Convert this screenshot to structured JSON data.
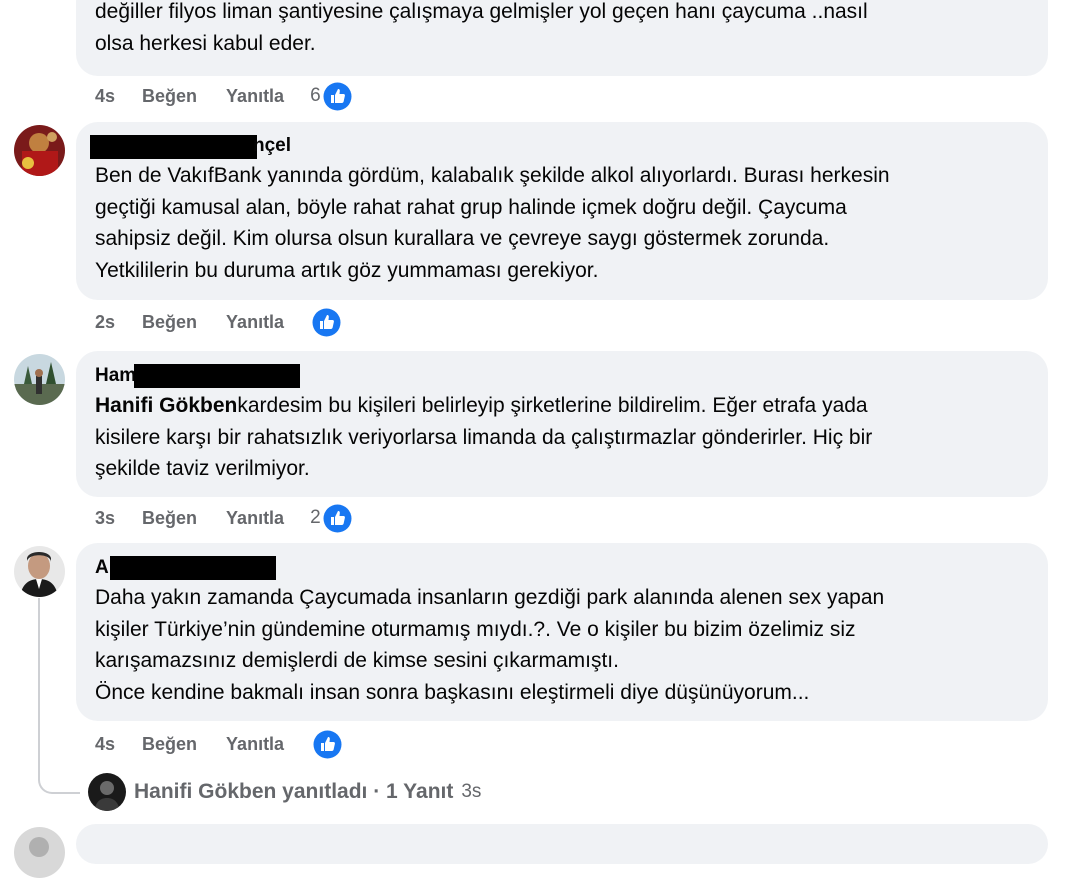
{
  "comments": [
    {
      "text_lines": [
        "değiller filyos liman şantiyesine çalışmaya gelmişler yol geçen hanı çaycuma ..nasıl",
        "olsa herkesi kabul eder."
      ],
      "time": "4s",
      "like_label": "Beğen",
      "reply_label": "Yanıtla",
      "reaction_count": "6"
    },
    {
      "name_visible": "nçel",
      "text_lines": [
        "Ben de VakıfBank yanında gördüm, kalabalık şekilde alkol alıyorlardı. Burası herkesin",
        "geçtiği kamusal alan, böyle rahat rahat grup halinde içmek doğru değil. Çaycuma",
        "sahipsiz değil. Kim olursa olsun kurallara ve çevreye saygı göstermek zorunda.",
        "Yetkililerin bu duruma artık göz yummaması gerekiyor."
      ],
      "time": "2s",
      "like_label": "Beğen",
      "reply_label": "Yanıtla",
      "reaction_count": ""
    },
    {
      "name_visible": "Ham",
      "mention": "Hanifi Gökben",
      "text_lines": [
        "kardesim bu kişileri belirleyip şirketlerine bildirelim. Eğer etrafa yada",
        "kisilere karşı bir rahatsızlık veriyorlarsa limanda da çalıştırmazlar gönderirler. Hiç bir",
        "şekilde taviz verilmiyor."
      ],
      "time": "3s",
      "like_label": "Beğen",
      "reply_label": "Yanıtla",
      "reaction_count": "2"
    },
    {
      "name_visible": "A",
      "text_lines": [
        "Daha yakın zamanda Çaycumada insanların gezdiği park alanında alenen sex yapan",
        "kişiler Türkiye’nin gündemine oturmamış mıydı.?. Ve o kişiler bu bizim özelimiz siz",
        "karışamazsınız demişlerdi de kimse sesini çıkarmamıştı.",
        "Önce kendine bakmalı insan sonra başkasını eleştirmeli diye düşünüyorum..."
      ],
      "time": "4s",
      "like_label": "Beğen",
      "reply_label": "Yanıtla",
      "reaction_count": ""
    }
  ],
  "replies_summary": {
    "text": "Hanifi Gökben yanıtladı · 1 Yanıt",
    "time": "3s"
  },
  "colors": {
    "bubble": "#f0f2f5",
    "secondary_text": "#65676b",
    "like_blue": "#1877f2"
  }
}
